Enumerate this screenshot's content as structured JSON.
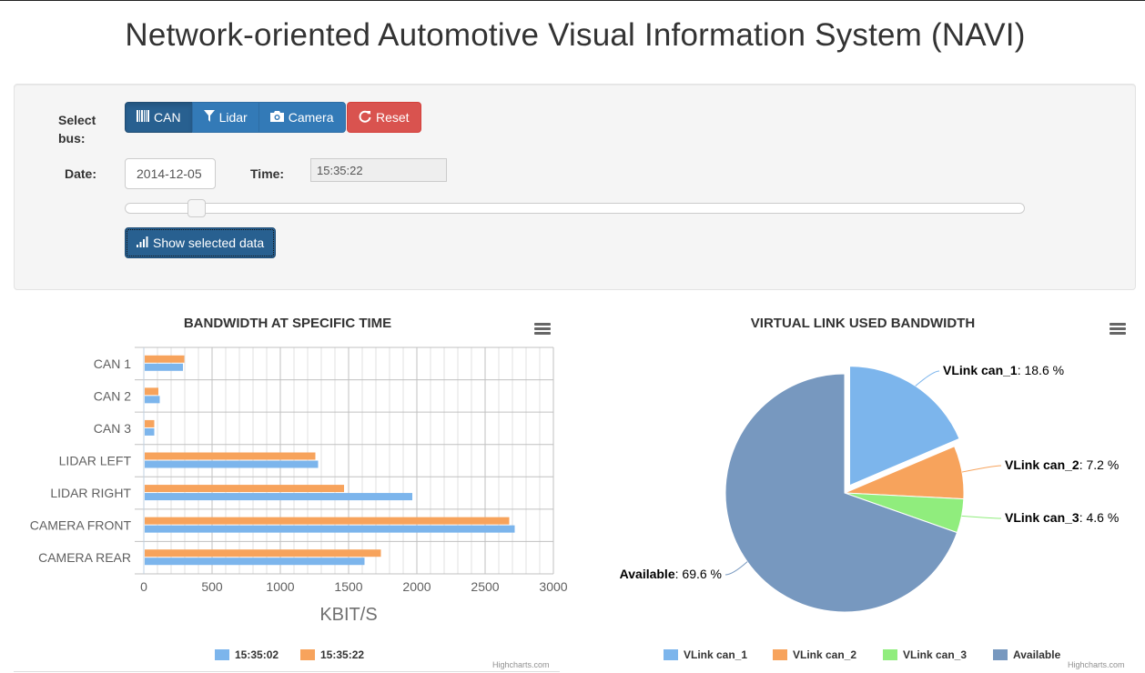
{
  "title": "Network-oriented Automotive Visual Information System (NAVI)",
  "controls": {
    "select_bus_label": "Select bus:",
    "buses": [
      {
        "label": "CAN",
        "icon": "barcode-icon",
        "active": true
      },
      {
        "label": "Lidar",
        "icon": "filter-icon",
        "active": false
      },
      {
        "label": "Camera",
        "icon": "camera-icon",
        "active": false
      }
    ],
    "reset_label": "Reset",
    "date_label": "Date:",
    "date_value": "2014-12-05",
    "time_label": "Time:",
    "time_value": "15:35:22",
    "time_slider_fraction": 0.07,
    "show_label": "Show selected data"
  },
  "bar_chart": {
    "menu_icon": "hamburger-menu-icon",
    "credits": "Highcharts.com"
  },
  "pie_chart": {
    "menu_icon": "hamburger-menu-icon",
    "credits": "Highcharts.com"
  },
  "chart_data": [
    {
      "type": "bar",
      "title": "BANDWIDTH AT SPECIFIC TIME",
      "categories": [
        "CAN 1",
        "CAN 2",
        "CAN 3",
        "LIDAR LEFT",
        "LIDAR RIGHT",
        "CAMERA FRONT",
        "CAMERA REAR"
      ],
      "xlabel": "KBIT/S",
      "xlim": [
        0,
        3000
      ],
      "ticks": [
        0,
        500,
        1000,
        1500,
        2000,
        2500,
        3000
      ],
      "grid": true,
      "legend_position": "bottom",
      "series": [
        {
          "name": "15:35:02",
          "color": "#7cb5ec",
          "values": [
            280,
            110,
            70,
            1270,
            1960,
            2710,
            1610
          ]
        },
        {
          "name": "15:35:22",
          "color": "#f7a35c",
          "values": [
            290,
            100,
            70,
            1250,
            1460,
            2670,
            1730
          ]
        }
      ]
    },
    {
      "type": "pie",
      "title": "VIRTUAL LINK USED BANDWIDTH",
      "legend_position": "bottom",
      "slices": [
        {
          "name": "VLink can_1",
          "value": 18.6,
          "label": "18.6 %",
          "color": "#7cb5ec",
          "sliced": true
        },
        {
          "name": "VLink can_2",
          "value": 7.2,
          "label": "7.2 %",
          "color": "#f7a35c",
          "sliced": false
        },
        {
          "name": "VLink can_3",
          "value": 4.6,
          "label": "4.6 %",
          "color": "#90ed7d",
          "sliced": false
        },
        {
          "name": "Available",
          "value": 69.6,
          "label": "69.6 %",
          "color": "#7798bf",
          "sliced": false
        }
      ]
    }
  ]
}
